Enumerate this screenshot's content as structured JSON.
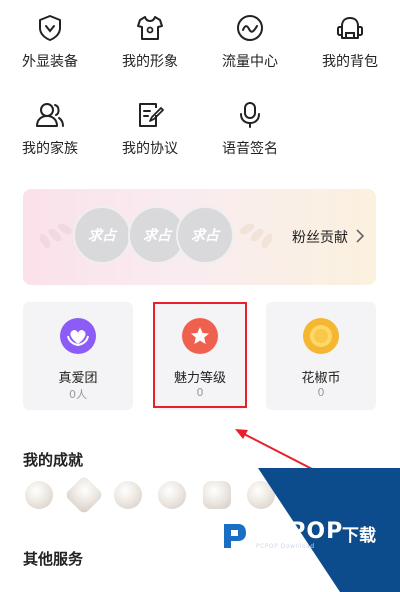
{
  "menu_rows": [
    [
      {
        "label": "外显装备",
        "icon": "shield-icon"
      },
      {
        "label": "我的形象",
        "icon": "shirt-icon"
      },
      {
        "label": "流量中心",
        "icon": "wave-icon"
      },
      {
        "label": "我的背包",
        "icon": "backpack-icon"
      }
    ],
    [
      {
        "label": "我的家族",
        "icon": "family-icon"
      },
      {
        "label": "我的协议",
        "icon": "agreement-icon"
      },
      {
        "label": "语音签名",
        "icon": "microphone-icon"
      }
    ]
  ],
  "fans": {
    "rank_labels": [
      "求占",
      "求占",
      "求占"
    ],
    "label": "粉丝贡献"
  },
  "cards": [
    {
      "title": "真爱团",
      "value": "0人",
      "color": "#8b5cf6",
      "icon": "heart-hands-icon"
    },
    {
      "title": "魅力等级",
      "value": "0",
      "color": "#f0604e",
      "icon": "star-icon"
    },
    {
      "title": "花椒币",
      "value": "0",
      "color": "#f5b731",
      "icon": "coin-icon"
    }
  ],
  "achievements": {
    "title": "我的成就",
    "medal_count": 6
  },
  "other_services": {
    "title": "其他服务"
  },
  "watermark": {
    "brand": "PCPOP",
    "cn": "下载",
    "sub": "PCPOP Download"
  },
  "colors": {
    "highlight": "#e8202a",
    "watermark_blue": "#0d4c8c"
  }
}
